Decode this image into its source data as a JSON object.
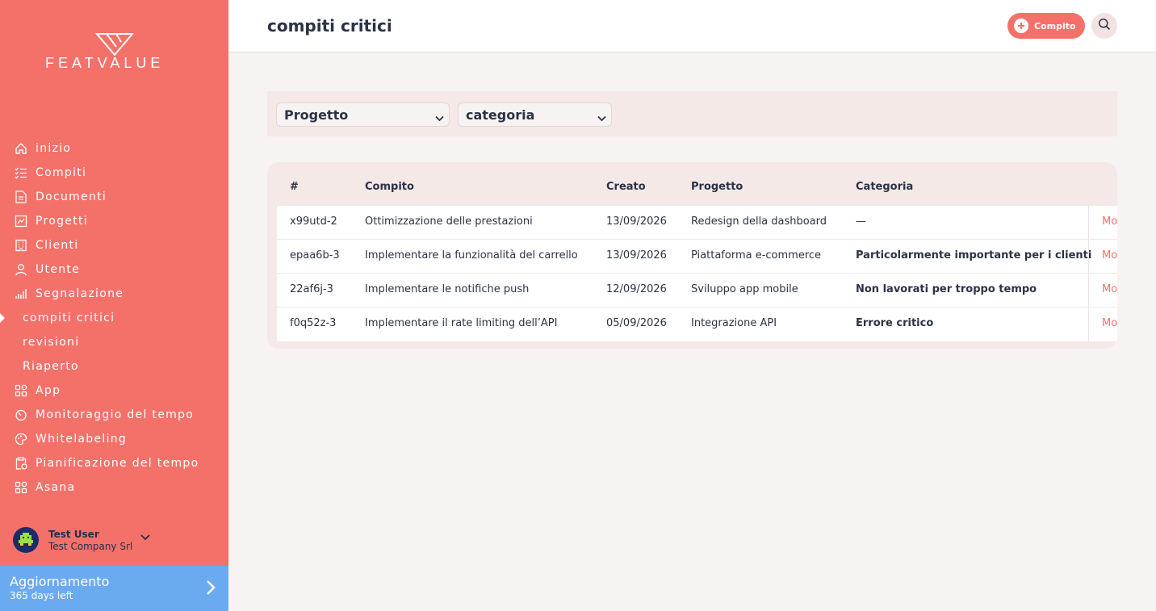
{
  "brand": {
    "logo_text": "FEATVALUE"
  },
  "sidebar": {
    "items": [
      {
        "label": "inizio",
        "icon": "home-icon"
      },
      {
        "label": "Compiti",
        "icon": "checklist-icon"
      },
      {
        "label": "Documenti",
        "icon": "document-icon"
      },
      {
        "label": "Progetti",
        "icon": "chart-icon"
      },
      {
        "label": "Clienti",
        "icon": "building-icon"
      },
      {
        "label": "Utente",
        "icon": "user-icon"
      },
      {
        "label": "Segnalazione",
        "icon": "bar-chart-icon"
      }
    ],
    "sub_items": [
      {
        "label": "compiti critici",
        "active": true
      },
      {
        "label": "revisioni"
      },
      {
        "label": "Riaperto"
      }
    ],
    "items_after": [
      {
        "label": "App",
        "icon": "apps-icon"
      },
      {
        "label": "Monitoraggio del tempo",
        "icon": "timer-icon"
      },
      {
        "label": "Whitelabeling",
        "icon": "palette-icon"
      },
      {
        "label": "Pianificazione del tempo",
        "icon": "clipboard-clock-icon"
      },
      {
        "label": "Asana",
        "icon": "apps-icon"
      }
    ]
  },
  "user": {
    "name": "Test User",
    "company": "Test Company Srl"
  },
  "upgrade": {
    "title": "Aggiornamento",
    "subtitle": "365 days left"
  },
  "header": {
    "title": "compiti critici",
    "add_button_label": "Compito"
  },
  "filters": {
    "project_select": "Progetto",
    "category_select": "categoria"
  },
  "table": {
    "columns": [
      "#",
      "Compito",
      "Creato",
      "Progetto",
      "Categoria"
    ],
    "rows": [
      {
        "id": "x99utd-2",
        "task": "Ottimizzazione delle prestazioni",
        "created": "13/09/2026",
        "project": "Redesign della dashboard",
        "category": "—",
        "action": "Mo"
      },
      {
        "id": "epaa6b-3",
        "task": "Implementare la funzionalità del carrello",
        "created": "13/09/2026",
        "project": "Piattaforma e-commerce",
        "category": "Particolarmente importante per i clienti",
        "action": "Mo"
      },
      {
        "id": "22af6j-3",
        "task": "Implementare le notifiche push",
        "created": "12/09/2026",
        "project": "Sviluppo app mobile",
        "category": "Non lavorati per troppo tempo",
        "action": "Mo"
      },
      {
        "id": "f0q52z-3",
        "task": "Implementare il rate limiting dell’API",
        "created": "05/09/2026",
        "project": "Integrazione API",
        "category": "Errore critico",
        "action": "Mo"
      }
    ]
  },
  "colors": {
    "sidebar": "#f4716a",
    "accent": "#f4716a",
    "upgrade": "#6aaaf0",
    "text": "#2b3245"
  }
}
